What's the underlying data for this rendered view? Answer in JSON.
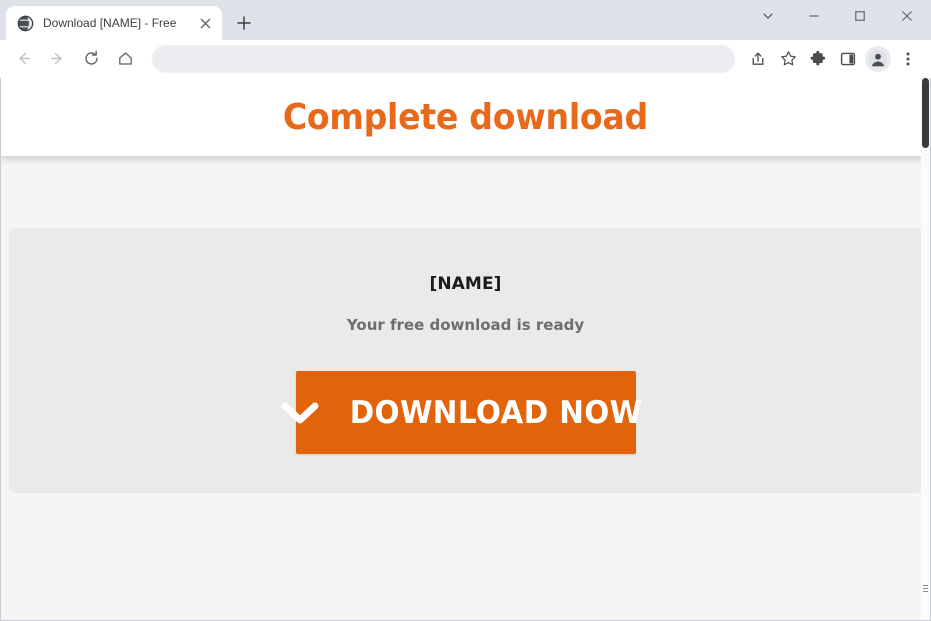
{
  "window": {
    "controls": [
      {
        "name": "tab-search",
        "icon": "chevron-down-icon",
        "label": "Search tabs"
      },
      {
        "name": "minimize",
        "icon": "minimize-icon",
        "label": "Minimize"
      },
      {
        "name": "maximize",
        "icon": "maximize-icon",
        "label": "Maximize"
      },
      {
        "name": "close",
        "icon": "close-icon",
        "label": "Close"
      }
    ]
  },
  "tabs": [
    {
      "title": "Download [NAME] - Free",
      "favicon": "globe-icon",
      "close_label": "×",
      "active": true
    }
  ],
  "new_tab": {
    "label": "+",
    "tooltip": "New tab"
  },
  "toolbar": {
    "back": {
      "icon": "arrow-left-icon",
      "label": "Back",
      "enabled": false
    },
    "forward": {
      "icon": "arrow-right-icon",
      "label": "Forward",
      "enabled": false
    },
    "reload": {
      "icon": "reload-icon",
      "label": "Reload"
    },
    "home": {
      "icon": "home-icon",
      "label": "Home"
    },
    "omnibox": {
      "value": "",
      "placeholder": ""
    },
    "actions": [
      {
        "name": "share-icon",
        "label": "Share this page"
      },
      {
        "name": "bookmark-star-icon",
        "label": "Bookmark this tab"
      },
      {
        "name": "extensions-puzzle-icon",
        "label": "Extensions"
      },
      {
        "name": "side-panel-icon",
        "label": "Side panel"
      },
      {
        "name": "profile-avatar-icon",
        "label": "Profile"
      },
      {
        "name": "more-menu-icon",
        "label": "Customize and control"
      }
    ]
  },
  "page": {
    "header_title": "Complete download",
    "card": {
      "file_name": "[NAME]",
      "status_text": "Your free download is ready",
      "download_button": {
        "label": "DOWNLOAD NOW",
        "icon": "chevron-down-icon"
      }
    }
  },
  "colors": {
    "brand_orange": "#e8691a",
    "button_orange": "#e2630a",
    "page_background": "#f5f5f5",
    "card_background": "#eaeaea",
    "heading_text": "#e8691a",
    "status_text": "#6e6e6e",
    "file_name_text": "#1b1b1b"
  }
}
